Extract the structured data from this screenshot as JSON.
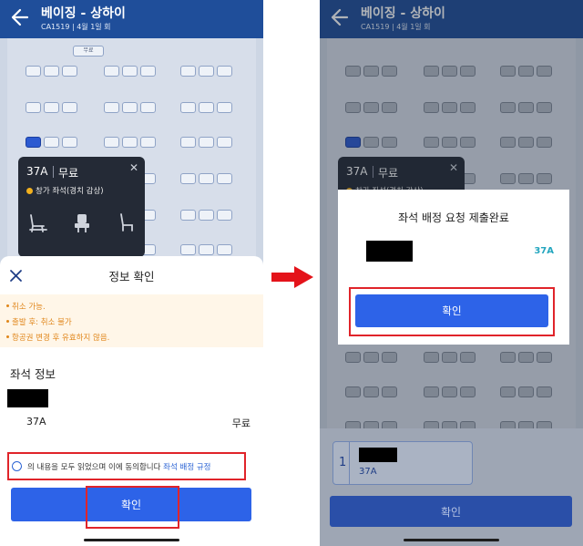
{
  "left": {
    "header": {
      "title": "베이징 - 상하이",
      "subtitle": "CA1519 | 4월 1일 회"
    },
    "seatmap": {
      "free_tag": "무료",
      "selected_seat": "37A"
    },
    "tooltip": {
      "seat": "37A",
      "price": "무료",
      "feature": "창가 좌석(경치 감상)"
    },
    "sheet": {
      "title": "정보 확인",
      "notices": [
        "취소 가능.",
        "출발 후: 취소 불가",
        "항공권 변경 후 유효하지 않음."
      ],
      "section_title": "좌석 정보",
      "seat_code": "37A",
      "seat_price": "무료",
      "agree_text": "의 내용을 모두 읽었으며 이에 동의합니다",
      "agree_link": "좌석 배정 규정",
      "confirm_label": "확인"
    }
  },
  "right": {
    "header": {
      "title": "베이징 - 상하이",
      "subtitle": "CA1519 | 4월 1일 회"
    },
    "tooltip": {
      "seat": "37A",
      "price": "무료",
      "feature": "창가 좌석(경치 감상)"
    },
    "dialog": {
      "title": "좌석 배정 요청 제출완료",
      "seat": "37A",
      "confirm_label": "확인"
    },
    "bottom": {
      "passenger_index": "1",
      "seat_code": "37A",
      "confirm_label": "확인"
    }
  },
  "colors": {
    "primary": "#2d63e8",
    "header": "#1f4e9a",
    "highlight": "#e0242a",
    "notice": "#e0861a",
    "seat_text": "#24a6bf"
  }
}
